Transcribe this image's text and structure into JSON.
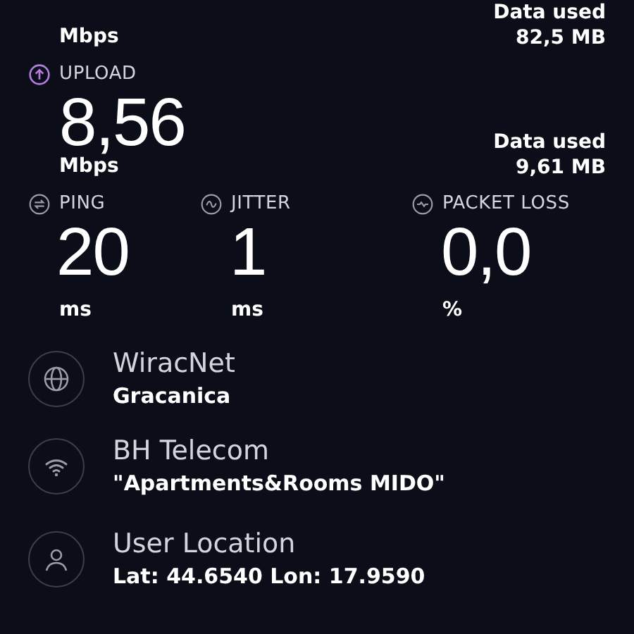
{
  "download_tail": {
    "unit": "Mbps",
    "data_used_label": "Data used",
    "data_used": "82,5 MB"
  },
  "upload": {
    "label": "UPLOAD",
    "value": "8,56",
    "unit": "Mbps",
    "data_used_label": "Data used",
    "data_used": "9,61 MB"
  },
  "metrics": [
    {
      "kind": "ping",
      "label": "PING",
      "value": "20",
      "unit": "ms"
    },
    {
      "kind": "jitter",
      "label": "JITTER",
      "value": "1",
      "unit": "ms"
    },
    {
      "kind": "packet_loss",
      "label": "PACKET LOSS",
      "value": "0,0",
      "unit": "%"
    }
  ],
  "info": [
    {
      "kind": "isp",
      "title": "WiracNet",
      "subtitle": "Gracanica"
    },
    {
      "kind": "wifi",
      "title": "BH Telecom",
      "subtitle": "\"Apartments&Rooms MIDO\""
    },
    {
      "kind": "location",
      "title": "User Location",
      "subtitle": "Lat: 44.6540 Lon: 17.9590"
    }
  ]
}
